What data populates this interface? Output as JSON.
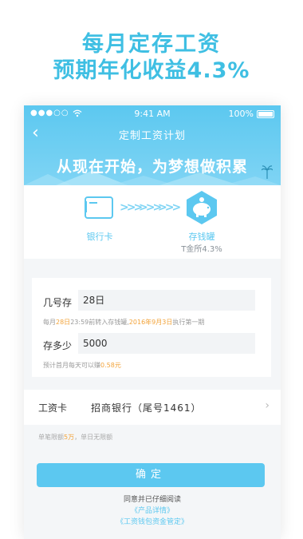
{
  "promo": {
    "line1": "每月定存工资",
    "line2": "预期年化收益4.3%"
  },
  "statusbar": {
    "signal": "●●●○○",
    "time": "9:41 AM",
    "battery": "100%"
  },
  "nav": {
    "back": "‹",
    "title": "定制工资计划"
  },
  "banner": {
    "slogan": "从现在开始，为梦想做积累"
  },
  "flow": {
    "from_label": "银行卡",
    "to_label": "存钱罐",
    "to_sub": "T金所4.3%",
    "arrows": ">>>"
  },
  "form": {
    "day_label": "几号存",
    "day_value": "28日",
    "day_note_prefix": "每月",
    "day_note_day": "28日",
    "day_note_mid": "23:59前转入存钱罐,",
    "day_note_date": "2016年9月3日",
    "day_note_suffix": "执行第一期",
    "amount_label": "存多少",
    "amount_value": "5000",
    "amount_note_prefix": "预计首月每天可以赚",
    "amount_note_value": "0.58元"
  },
  "salary_card": {
    "label": "工资卡",
    "value": "招商银行（尾号1461）",
    "chevron": "›"
  },
  "limit": {
    "prefix": "单笔限额",
    "amount": "5万",
    "suffix": "，单日无限额"
  },
  "confirm": {
    "label": "确定"
  },
  "agreement": {
    "text": "同意并已仔细阅读",
    "link1": "《产品详情》",
    "link2": "《工资钱包资金管定》"
  },
  "colors": {
    "accent": "#5cc8f0",
    "highlight": "#f2a33a"
  }
}
